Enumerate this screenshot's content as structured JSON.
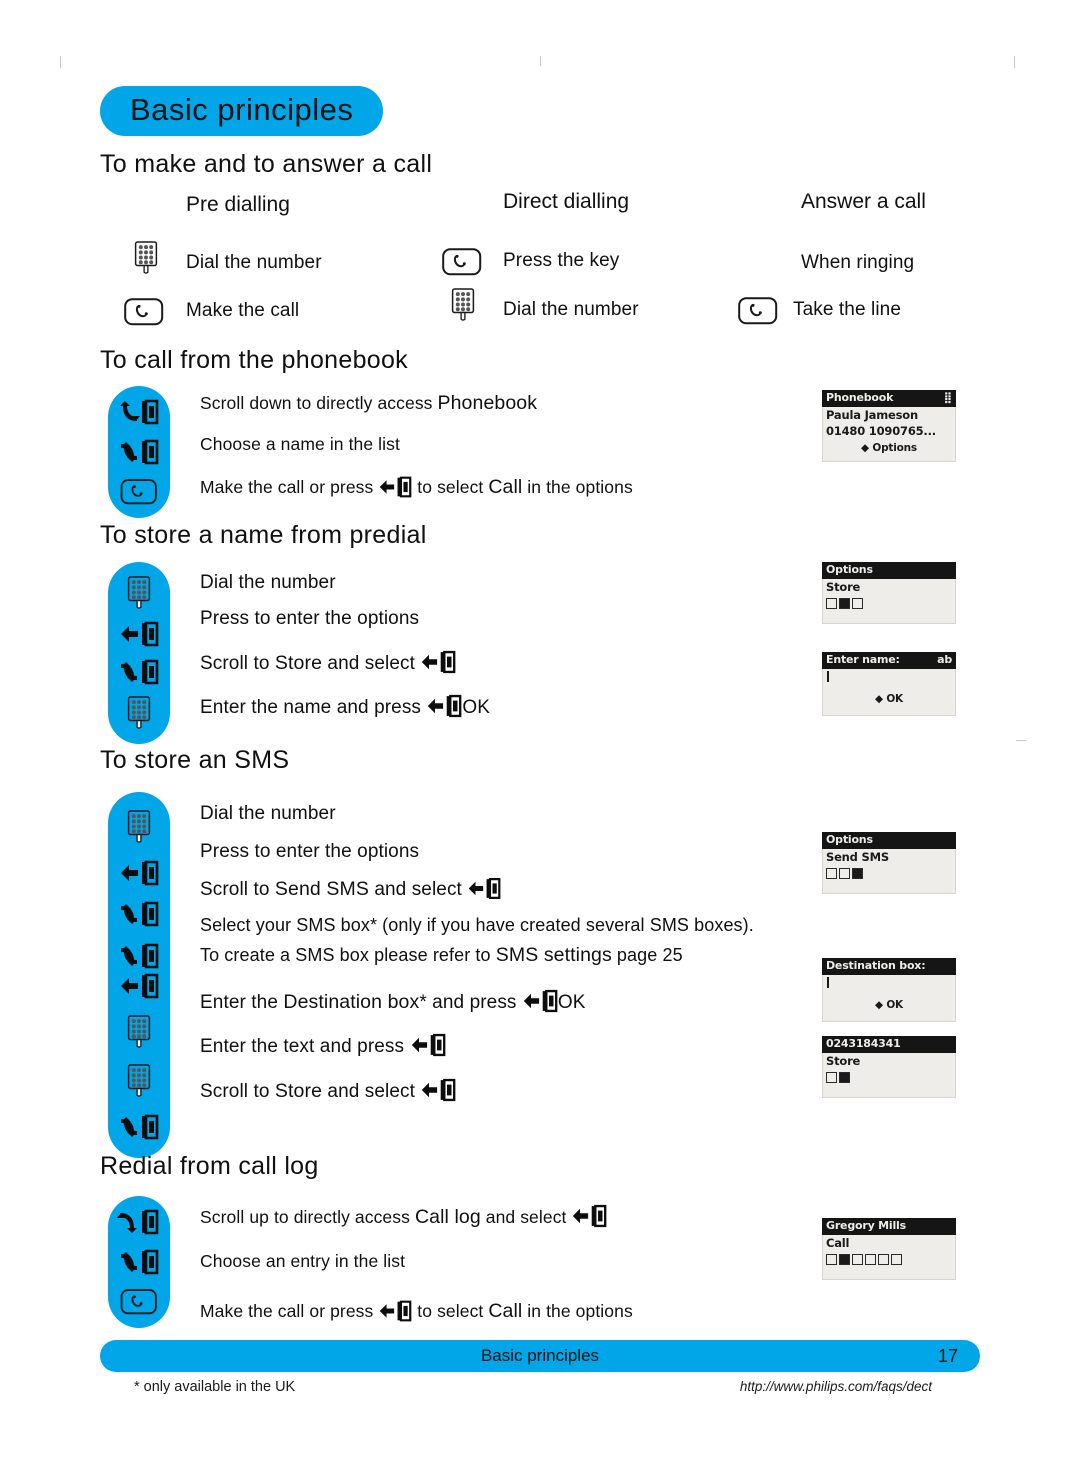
{
  "page": {
    "title": "Basic principles",
    "footer_title": "Basic principles",
    "page_number": "17",
    "footnote": "* only available in the UK",
    "url": "http://www.philips.com/faqs/dect",
    "accent_color": "#00A6E8",
    "lcd_bg": "#EFEDE9",
    "lcd_bar": "#151515"
  },
  "sections": {
    "make_answer": {
      "heading": "To make and to answer a call",
      "columns": [
        {
          "subhead": "Pre dialling",
          "steps": [
            {
              "icon": "keypad-icon",
              "text": "Dial the number"
            },
            {
              "icon": "call-key-icon",
              "text": "Make the call"
            }
          ]
        },
        {
          "subhead": "Direct dialling",
          "steps": [
            {
              "icon": "call-key-icon",
              "text": "Press the key"
            },
            {
              "icon": "keypad-icon",
              "text": "Dial the number"
            }
          ]
        },
        {
          "subhead": "Answer a call",
          "steps": [
            {
              "icon": "none",
              "text": "When ringing"
            },
            {
              "icon": "call-key-icon",
              "text": "Take the line"
            }
          ]
        }
      ]
    },
    "phonebook": {
      "heading": "To call from the phonebook",
      "rail_icons": [
        "nav-down-icon",
        "nav-updown-icon",
        "call-key-icon"
      ],
      "steps": [
        {
          "pre": "Scroll down to directly access ",
          "em": "Phonebook",
          "post": ""
        },
        {
          "pre": "Choose a name in the list",
          "em": "",
          "post": ""
        },
        {
          "pre": "Make the call or press ",
          "icon": "nav-select-icon",
          "mid": " to select ",
          "em": "Call",
          "post": " in the options"
        }
      ],
      "screen": {
        "title": "Phonebook",
        "title_right": "scroll-indicator",
        "line1": "Paula Jameson",
        "line2": "01480 1090765...",
        "soft": "Options"
      }
    },
    "store_name": {
      "heading": "To store a name from predial",
      "rail_icons": [
        "keypad-icon",
        "nav-select-icon",
        "nav-updown-icon",
        "keypad-icon"
      ],
      "steps": [
        {
          "pre": "Dial the number"
        },
        {
          "pre": "Press to enter the options"
        },
        {
          "pre": "Scroll to ",
          "em": "Store",
          "mid": " and select ",
          "icon": "nav-select-icon"
        },
        {
          "pre": "Enter the name and press ",
          "icon": "nav-select-icon",
          "post": "OK"
        }
      ],
      "screens": [
        {
          "title": "Options",
          "line1": "Store",
          "icons": [
            "off",
            "on",
            "off"
          ]
        },
        {
          "title": "Enter name:",
          "title_right": "ab",
          "line1": "",
          "soft": "OK"
        }
      ]
    },
    "store_sms": {
      "heading": "To store an SMS",
      "rail_icons": [
        "keypad-icon",
        "nav-select-icon",
        "nav-updown-icon",
        "nav-updown-icon",
        "nav-select-icon",
        "keypad-icon",
        "keypad-icon",
        "nav-updown-icon"
      ],
      "steps": [
        {
          "pre": "Dial the number"
        },
        {
          "pre": "Press to enter the options"
        },
        {
          "pre": "Scroll to ",
          "em": "Send SMS",
          "mid": " and select ",
          "icon": "nav-select-icon"
        },
        {
          "pre": "Select your SMS box* (only if you have created several SMS boxes)."
        },
        {
          "pre": "To create a SMS box please refer to ",
          "em": "SMS settings",
          "post": " page 25"
        },
        {
          "pre": "Enter the ",
          "em": "Destination box",
          "mid": "* and press ",
          "icon": "nav-select-icon",
          "post": "OK"
        },
        {
          "pre": "Enter the text and press ",
          "icon": "nav-select-icon"
        },
        {
          "pre": "Scroll to ",
          "em": "Store",
          "mid": " and select ",
          "icon": "nav-select-icon"
        }
      ],
      "screens": [
        {
          "title": "Options",
          "line1": "Send SMS",
          "icons": [
            "off",
            "off",
            "on"
          ]
        },
        {
          "title": "Destination box:",
          "line1": "",
          "soft": "OK"
        },
        {
          "title": "0243184341",
          "line1": "Store",
          "icons": [
            "off",
            "on"
          ]
        }
      ]
    },
    "redial": {
      "heading": "Redial from call log",
      "rail_icons": [
        "nav-up-icon",
        "nav-updown-icon",
        "call-key-icon"
      ],
      "steps": [
        {
          "pre": "Scroll up to directly access ",
          "em": "Call log",
          "mid": " and select ",
          "icon": "nav-select-icon"
        },
        {
          "pre": "Choose an entry in the list"
        },
        {
          "pre": "Make the call or press ",
          "icon": "nav-select-icon",
          "mid": " to select ",
          "em": "Call",
          "post": " in the options"
        }
      ],
      "screen": {
        "title": "Gregory Mills",
        "line1": "Call",
        "icons": [
          "off",
          "on",
          "off",
          "off",
          "off",
          "off"
        ]
      }
    }
  }
}
